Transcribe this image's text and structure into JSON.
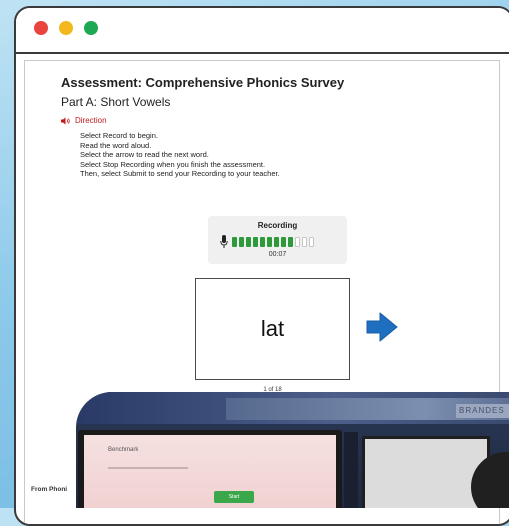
{
  "assessment": {
    "title": "Assessment: Comprehensive Phonics Survey",
    "subtitle": "Part A: Short Vowels",
    "direction_label": "Direction",
    "instructions": [
      "Select Record to begin.",
      "Read the word aloud.",
      "Select the arrow to read the next word.",
      "Select Stop Recording when you finish the assessment.",
      "Then, select Submit to send your Recording to your teacher."
    ]
  },
  "recording": {
    "label": "Recording",
    "time": "00:07",
    "level": 0.75,
    "segments_total": 12,
    "segments_on": 9
  },
  "word_card": {
    "word": "lat",
    "page_count": "1 of 18"
  },
  "footer": {
    "source": "From Phoni"
  },
  "photo": {
    "screen_logo": "Benchmark",
    "screen_button": "Start",
    "board_text": "BRANDES"
  },
  "colors": {
    "close": "#e8433e",
    "minimize": "#f2b81d",
    "maximize": "#1fa853",
    "direction_red": "#c21d1d",
    "level_green": "#2e9a3c",
    "arrow_blue": "#1e6fc0"
  },
  "icons": {
    "direction": "speaker-icon",
    "mic": "microphone-icon",
    "next": "arrow-right-icon"
  }
}
